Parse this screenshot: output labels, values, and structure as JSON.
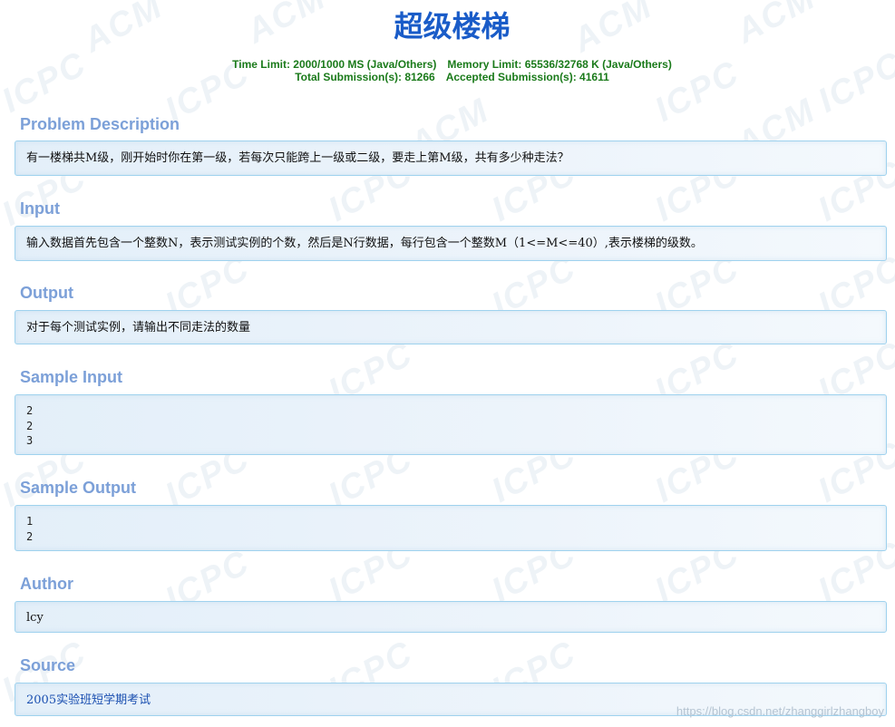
{
  "title": "超级楼梯",
  "limits": {
    "time": "Time Limit: 2000/1000 MS (Java/Others)",
    "memory": "Memory Limit: 65536/32768 K (Java/Others)",
    "total": "Total Submission(s): 81266",
    "accepted": "Accepted Submission(s): 41611"
  },
  "sections": {
    "description": {
      "title": "Problem Description",
      "content": "有一楼梯共M级，刚开始时你在第一级，若每次只能跨上一级或二级，要走上第M级，共有多少种走法？"
    },
    "input": {
      "title": "Input",
      "content": "输入数据首先包含一个整数N，表示测试实例的个数，然后是N行数据，每行包含一个整数M（1<=M<=40）,表示楼梯的级数。"
    },
    "output": {
      "title": "Output",
      "content": "对于每个测试实例，请输出不同走法的数量"
    },
    "sample_input": {
      "title": "Sample Input",
      "content": "2\n2\n3"
    },
    "sample_output": {
      "title": "Sample Output",
      "content": "1\n2"
    },
    "author": {
      "title": "Author",
      "content": "lcy"
    },
    "source": {
      "title": "Source",
      "content": "2005实验班短学期考试"
    }
  },
  "watermark": {
    "words": [
      "ACM",
      "ICPC"
    ],
    "color": "#eef3f7"
  },
  "footer": "https://blog.csdn.net/zhanggirlzhangboy",
  "colors": {
    "title": "#1a5cc8",
    "limits": "#1a7a1a",
    "section_title": "#7ca0d8",
    "panel_border": "#9fd2ee",
    "link": "#1a4fb0"
  }
}
